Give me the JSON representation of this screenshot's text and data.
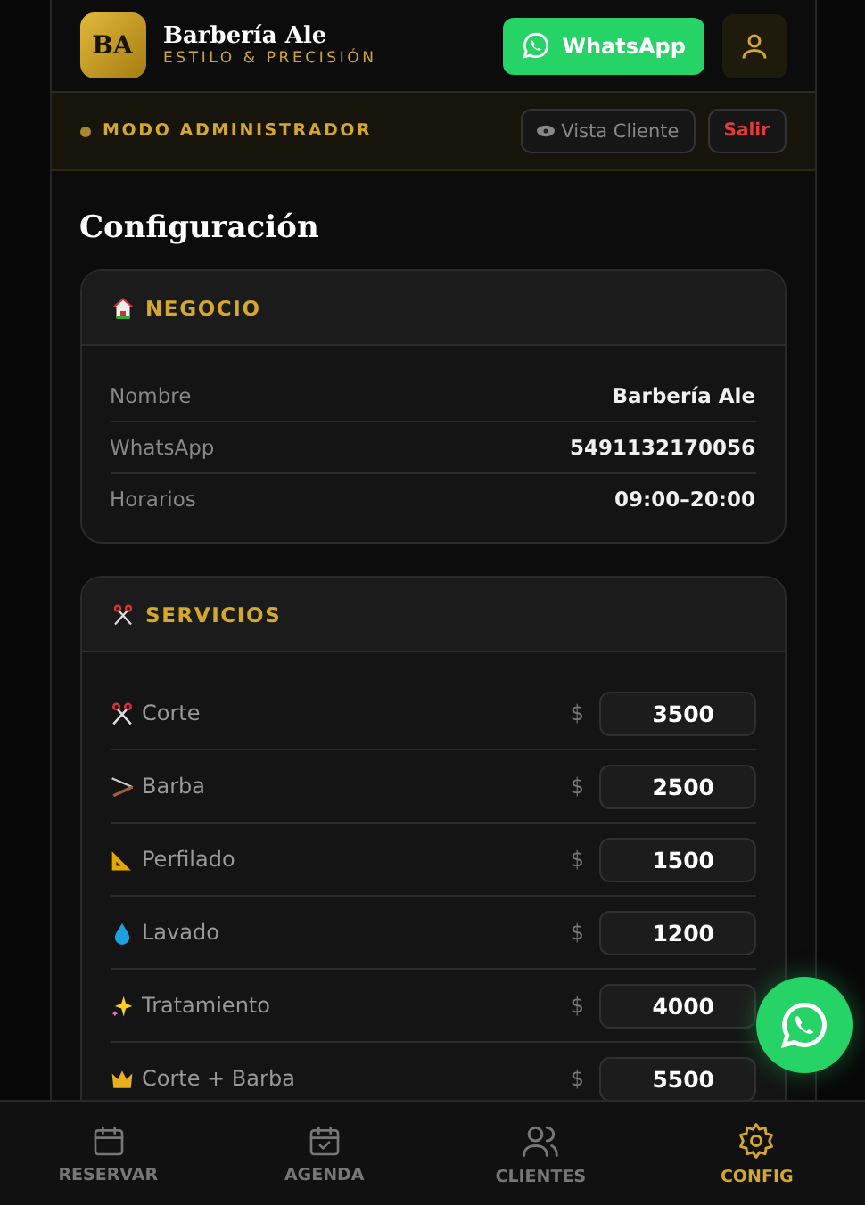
{
  "header": {
    "logo": "BA",
    "title": "Barbería Ale",
    "subtitle": "ESTILO & PRECISIÓN",
    "whatsapp_button": "WhatsApp"
  },
  "admin_bar": {
    "label": "MODO ADMINISTRADOR",
    "view_button": "Vista Cliente",
    "logout_button": "Salir"
  },
  "page_title": "Configuración",
  "business": {
    "title": "NEGOCIO",
    "fields": [
      {
        "label": "Nombre",
        "value": "Barbería Ale"
      },
      {
        "label": "WhatsApp",
        "value": "5491132170056"
      },
      {
        "label": "Horarios",
        "value": "09:00–20:00"
      }
    ]
  },
  "services": {
    "title": "SERVICIOS",
    "items": [
      {
        "name": "Corte",
        "currency": "$",
        "price": "3500"
      },
      {
        "name": "Barba",
        "currency": "$",
        "price": "2500"
      },
      {
        "name": "Perfilado",
        "currency": "$",
        "price": "1500"
      },
      {
        "name": "Lavado",
        "currency": "$",
        "price": "1200"
      },
      {
        "name": "Tratamiento",
        "currency": "$",
        "price": "4000"
      },
      {
        "name": "Corte + Barba",
        "currency": "$",
        "price": "5500"
      }
    ]
  },
  "bottom_nav": [
    {
      "label": "RESERVAR",
      "selected": false
    },
    {
      "label": "AGENDA",
      "selected": false
    },
    {
      "label": "CLIENTES",
      "selected": false
    },
    {
      "label": "CONFIG",
      "selected": true
    }
  ]
}
